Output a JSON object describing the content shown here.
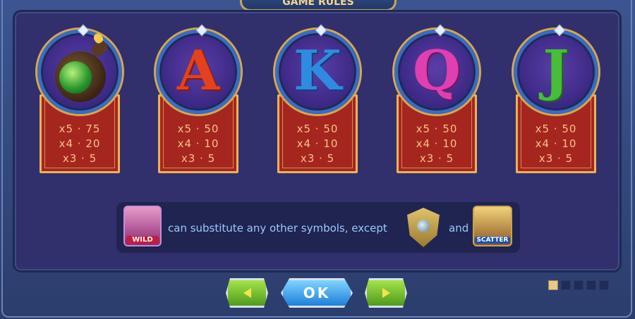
{
  "title": "GAME RULES",
  "symbols": [
    {
      "name": "bomb",
      "pays": [
        "x5 · 75",
        "x4 · 20",
        "x3 · 5"
      ]
    },
    {
      "name": "A",
      "letter": "A",
      "color": "#d9351a",
      "pays": [
        "x5 · 50",
        "x4 · 10",
        "x3 · 5"
      ]
    },
    {
      "name": "K",
      "letter": "K",
      "color": "#2a8ad9",
      "pays": [
        "x5 · 50",
        "x4 · 10",
        "x3 · 5"
      ]
    },
    {
      "name": "Q",
      "letter": "Q",
      "color": "#d93aa5",
      "pays": [
        "x5 · 50",
        "x4 · 10",
        "x3 · 5"
      ]
    },
    {
      "name": "J",
      "letter": "J",
      "color": "#3fb23a",
      "pays": [
        "x5 · 50",
        "x4 · 10",
        "x3 · 5"
      ]
    }
  ],
  "info": {
    "wild_label": "WILD",
    "text": "can substitute any other symbols, except",
    "and": "and",
    "scatter_label": "SCATTER"
  },
  "buttons": {
    "ok_label": "OK"
  },
  "pagination": {
    "current": 1,
    "total": 5
  }
}
